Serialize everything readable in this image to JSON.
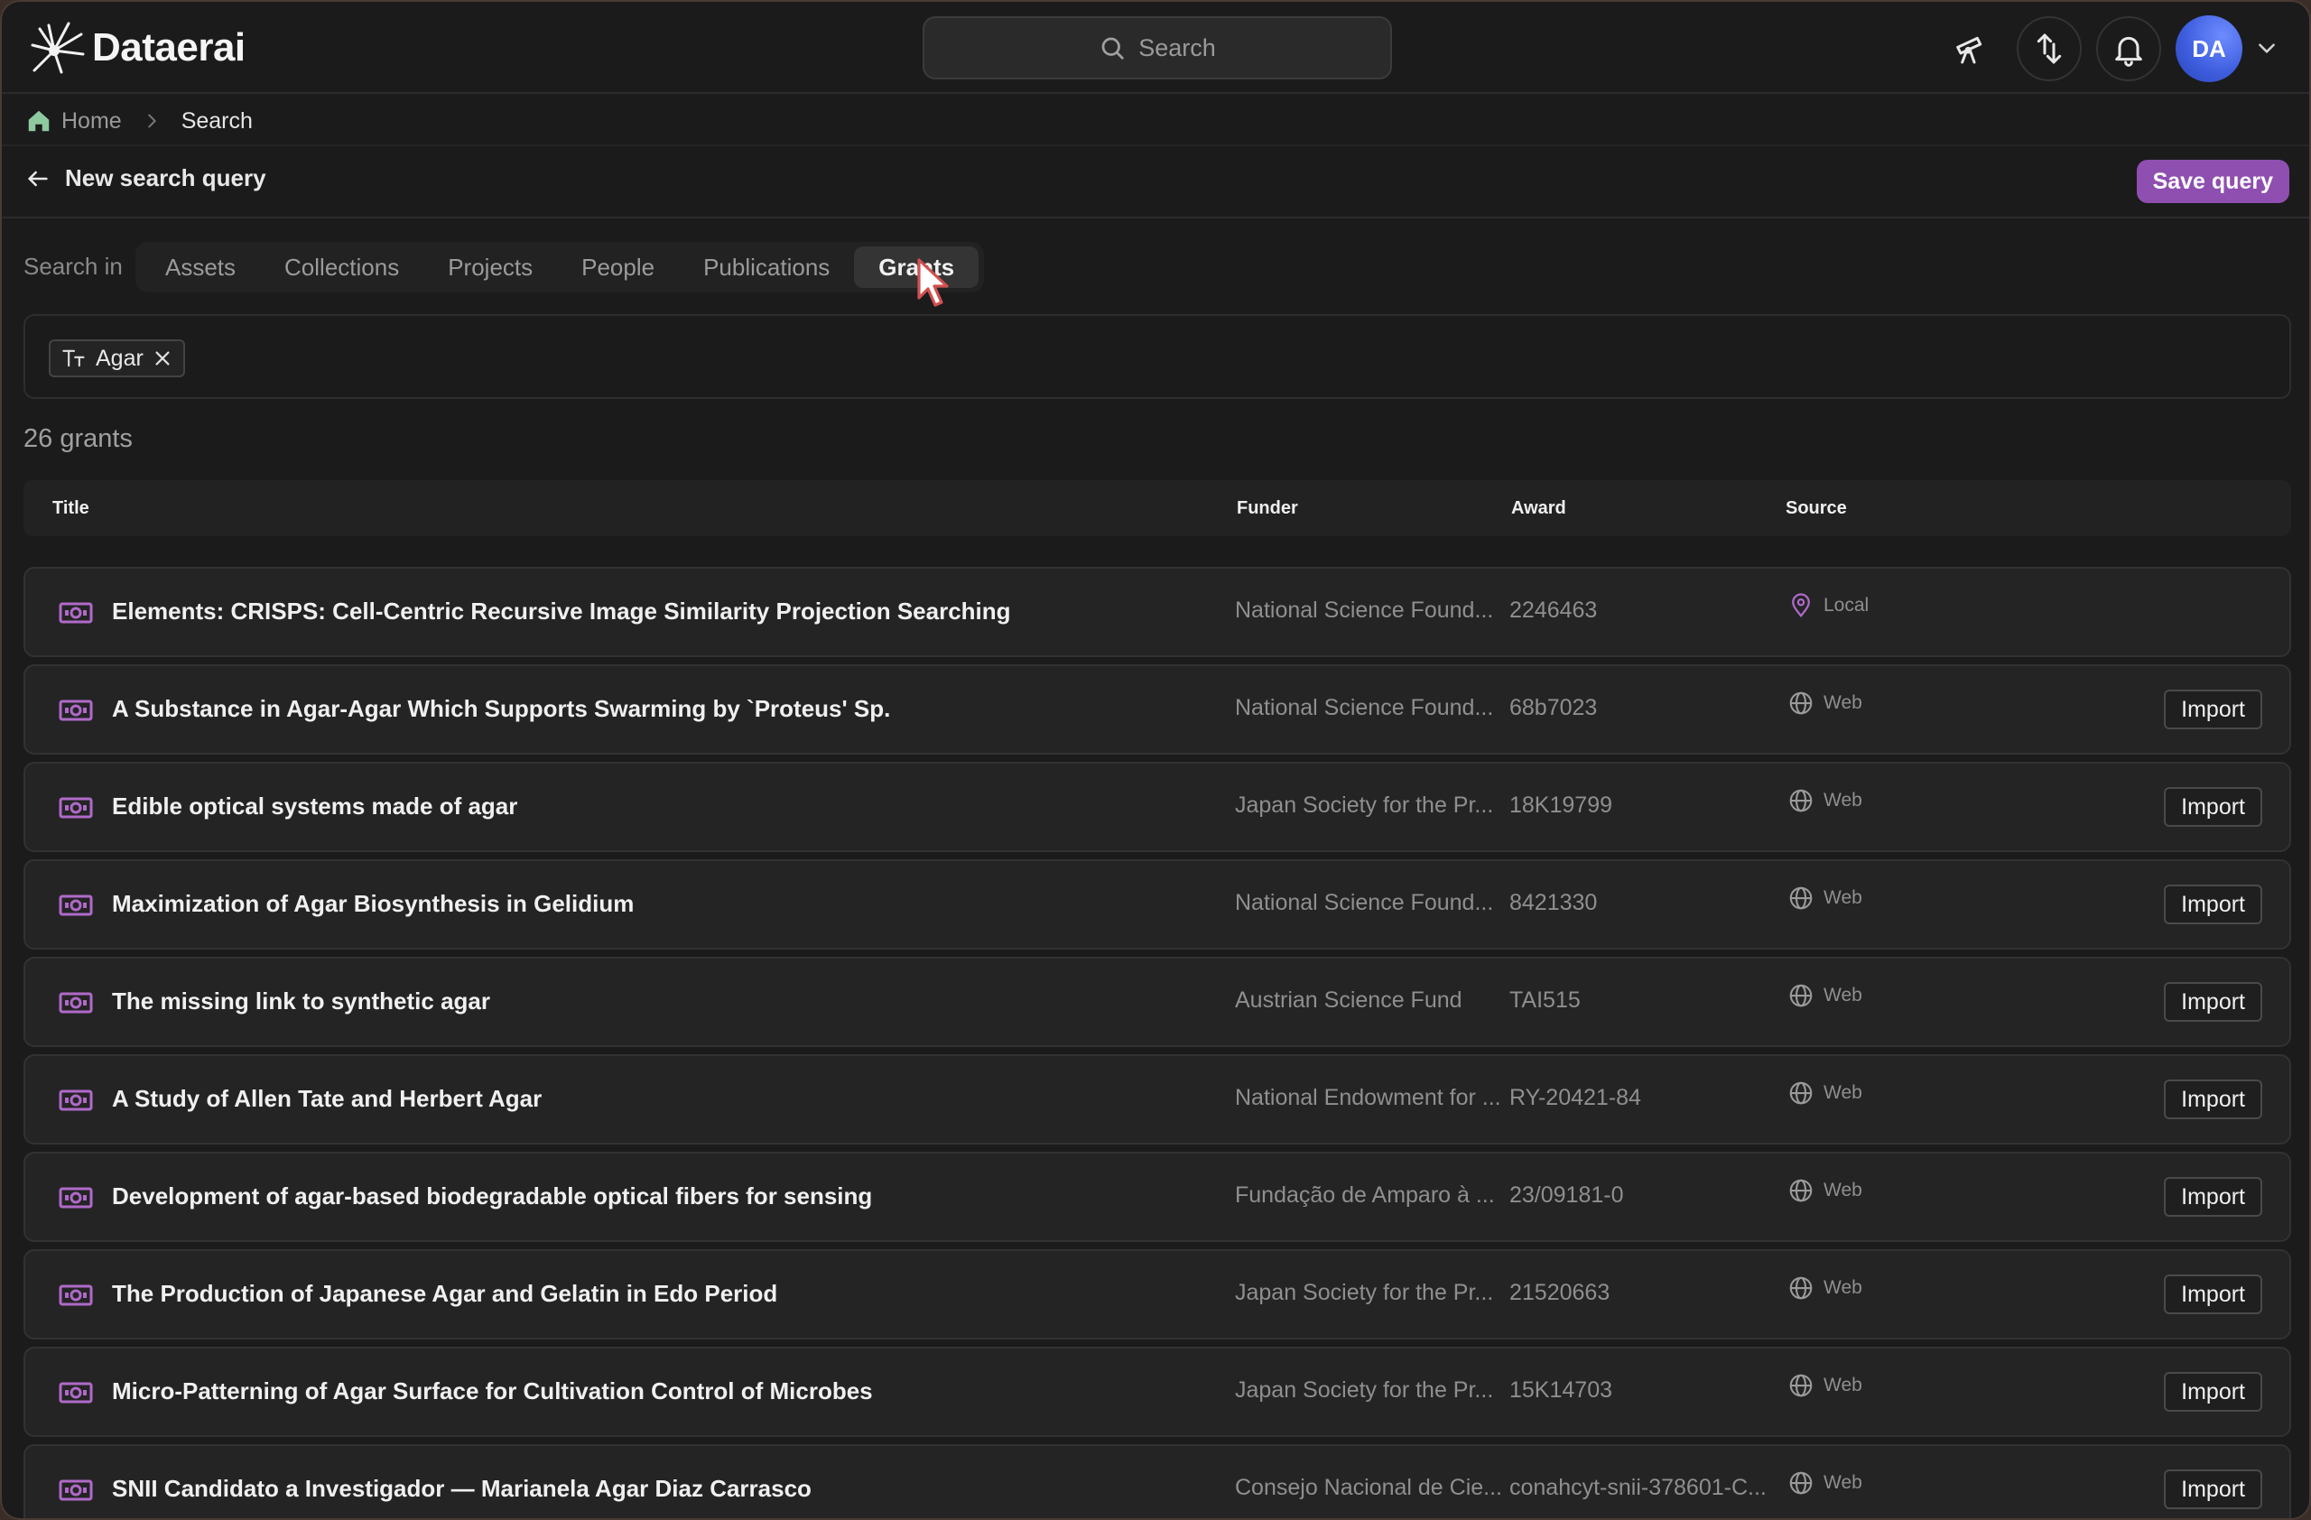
{
  "app": {
    "brand": "Dataerai",
    "search_placeholder": "Search",
    "avatar_initials": "DA"
  },
  "breadcrumb": {
    "home": "Home",
    "current": "Search"
  },
  "query": {
    "back_label": "New search query",
    "save_label": "Save query"
  },
  "tabs": {
    "prefix": "Search in",
    "items": [
      "Assets",
      "Collections",
      "Projects",
      "People",
      "Publications",
      "Grants"
    ],
    "active": "Grants"
  },
  "filters": {
    "chips": [
      {
        "label": "Agar",
        "type": "text"
      }
    ]
  },
  "results": {
    "count_label": "26 grants",
    "columns": {
      "title": "Title",
      "funder": "Funder",
      "award": "Award",
      "source": "Source"
    },
    "import_label": "Import",
    "rows": [
      {
        "title": "Elements: CRISPS: Cell-Centric Recursive Image Similarity Projection Searching",
        "funder": "National Science Found...",
        "award": "2246463",
        "source": "Local",
        "source_icon": "location-pin-icon",
        "importable": false
      },
      {
        "title": "A Substance in Agar-Agar Which Supports Swarming by `Proteus' Sp.",
        "funder": "National Science Found...",
        "award": "68b7023",
        "source": "Web",
        "source_icon": "globe-icon",
        "importable": true
      },
      {
        "title": "Edible optical systems made of agar",
        "funder": "Japan Society for the Pr...",
        "award": "18K19799",
        "source": "Web",
        "source_icon": "globe-icon",
        "importable": true
      },
      {
        "title": "Maximization of Agar Biosynthesis in Gelidium",
        "funder": "National Science Found...",
        "award": "8421330",
        "source": "Web",
        "source_icon": "globe-icon",
        "importable": true
      },
      {
        "title": "The missing link to synthetic agar",
        "funder": "Austrian Science Fund",
        "award": "TAI515",
        "source": "Web",
        "source_icon": "globe-icon",
        "importable": true
      },
      {
        "title": "A Study of Allen Tate and Herbert Agar",
        "funder": "National Endowment for ...",
        "award": "RY-20421-84",
        "source": "Web",
        "source_icon": "globe-icon",
        "importable": true
      },
      {
        "title": "Development of agar-based biodegradable optical fibers for sensing",
        "funder": "Fundação de Amparo à ...",
        "award": "23/09181-0",
        "source": "Web",
        "source_icon": "globe-icon",
        "importable": true
      },
      {
        "title": "The Production of Japanese Agar and Gelatin in Edo Period",
        "funder": "Japan Society for the Pr...",
        "award": "21520663",
        "source": "Web",
        "source_icon": "globe-icon",
        "importable": true
      },
      {
        "title": "Micro-Patterning of Agar Surface for Cultivation Control of Microbes",
        "funder": "Japan Society for the Pr...",
        "award": "15K14703",
        "source": "Web",
        "source_icon": "globe-icon",
        "importable": true
      },
      {
        "title": "SNII Candidato a Investigador — Marianela Agar Diaz Carrasco",
        "funder": "Consejo Nacional de Cie...",
        "award": "conahcyt-snii-378601-C...",
        "source": "Web",
        "source_icon": "globe-icon",
        "importable": true
      }
    ]
  },
  "colors": {
    "accent": "#8e4fb0",
    "grant_icon": "#b06ac9",
    "background": "#1b1b1c"
  }
}
